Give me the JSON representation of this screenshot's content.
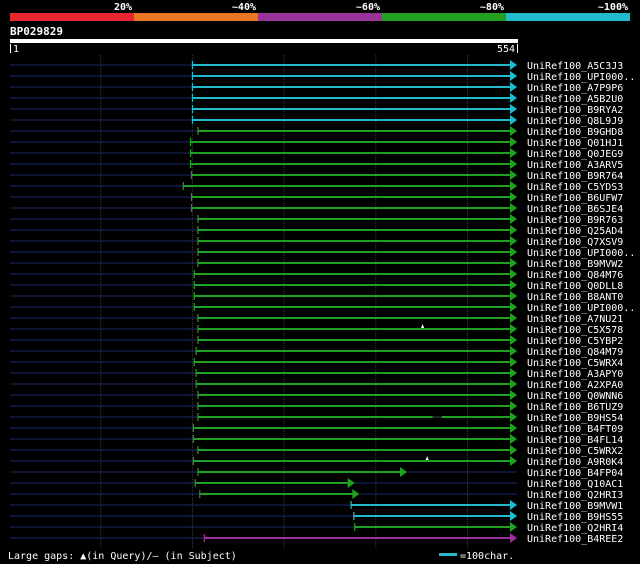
{
  "query": {
    "id": "BP029829",
    "start": "1",
    "end": "554",
    "length": 554
  },
  "identity_scale": [
    {
      "label": "20%",
      "color": "#e8262f"
    },
    {
      "label": "~40%",
      "color": "#e87722"
    },
    {
      "label": "~60%",
      "color": "#993399"
    },
    {
      "label": "~80%",
      "color": "#22a022"
    },
    {
      "label": "~100%",
      "color": "#22bbcc"
    }
  ],
  "footer": {
    "gaps_label": "Large gaps: ▲(in Query)/– (in Subject)",
    "scale_label": "=100char."
  },
  "chart_data": {
    "type": "alignment",
    "x_range": [
      1,
      554
    ],
    "tick_step": 100,
    "colors": {
      "100": "#22bbcc",
      "80": "#22a022",
      "60": "#993399"
    },
    "hits": [
      {
        "name": "UniRef100_A5C3J3",
        "start": 200,
        "end": 554,
        "identity": "100"
      },
      {
        "name": "UniRef100_UPI000..",
        "start": 200,
        "end": 554,
        "identity": "100"
      },
      {
        "name": "UniRef100_A7P9P6",
        "start": 200,
        "end": 554,
        "identity": "100"
      },
      {
        "name": "UniRef100_A5B2U0",
        "start": 200,
        "end": 554,
        "identity": "100"
      },
      {
        "name": "UniRef100_B9RYA2",
        "start": 200,
        "end": 554,
        "identity": "100"
      },
      {
        "name": "UniRef100_Q8L9J9",
        "start": 200,
        "end": 554,
        "identity": "100"
      },
      {
        "name": "UniRef100_B9GHD8",
        "start": 206,
        "end": 554,
        "identity": "80"
      },
      {
        "name": "UniRef100_Q01HJ1",
        "start": 198,
        "end": 554,
        "identity": "80"
      },
      {
        "name": "UniRef100_Q0JEG9",
        "start": 198,
        "end": 554,
        "identity": "80"
      },
      {
        "name": "UniRef100_A3ARV5",
        "start": 198,
        "end": 554,
        "identity": "80"
      },
      {
        "name": "UniRef100_B9R764",
        "start": 199,
        "end": 554,
        "identity": "80"
      },
      {
        "name": "UniRef100_C5YDS3",
        "start": 190,
        "end": 554,
        "identity": "80"
      },
      {
        "name": "UniRef100_B6UFW7",
        "start": 199,
        "end": 554,
        "identity": "80"
      },
      {
        "name": "UniRef100_B6SJE4",
        "start": 199,
        "end": 554,
        "identity": "80"
      },
      {
        "name": "UniRef100_B9R763",
        "start": 206,
        "end": 554,
        "identity": "80"
      },
      {
        "name": "UniRef100_Q25AD4",
        "start": 206,
        "end": 554,
        "identity": "80"
      },
      {
        "name": "UniRef100_Q7XSV9",
        "start": 206,
        "end": 554,
        "identity": "80"
      },
      {
        "name": "UniRef100_UPI000..",
        "start": 206,
        "end": 554,
        "identity": "80"
      },
      {
        "name": "UniRef100_B9MVW2",
        "start": 206,
        "end": 554,
        "identity": "80"
      },
      {
        "name": "UniRef100_Q84M76",
        "start": 202,
        "end": 554,
        "identity": "80"
      },
      {
        "name": "UniRef100_Q0DLL8",
        "start": 202,
        "end": 554,
        "identity": "80"
      },
      {
        "name": "UniRef100_B8ANT0",
        "start": 202,
        "end": 554,
        "identity": "80"
      },
      {
        "name": "UniRef100_UPI000..",
        "start": 202,
        "end": 554,
        "identity": "80"
      },
      {
        "name": "UniRef100_A7NU21",
        "start": 206,
        "end": 554,
        "identity": "80"
      },
      {
        "name": "UniRef100_C5X578",
        "start": 206,
        "end": 554,
        "identity": "80",
        "gap_query": 451
      },
      {
        "name": "UniRef100_C5YBP2",
        "start": 206,
        "end": 554,
        "identity": "80"
      },
      {
        "name": "UniRef100_Q84M79",
        "start": 204,
        "end": 554,
        "identity": "80"
      },
      {
        "name": "UniRef100_C5WRX4",
        "start": 202,
        "end": 554,
        "identity": "80"
      },
      {
        "name": "UniRef100_A3APY0",
        "start": 204,
        "end": 554,
        "identity": "80"
      },
      {
        "name": "UniRef100_A2XPA0",
        "start": 204,
        "end": 554,
        "identity": "80"
      },
      {
        "name": "UniRef100_Q0WNN6",
        "start": 206,
        "end": 554,
        "identity": "80"
      },
      {
        "name": "UniRef100_B6TUZ9",
        "start": 206,
        "end": 554,
        "identity": "80"
      },
      {
        "name": "UniRef100_B9HS54",
        "start": 206,
        "end": 554,
        "identity": "80",
        "gap_subject": [
          462,
          472
        ]
      },
      {
        "name": "UniRef100_B4FT09",
        "start": 201,
        "end": 554,
        "identity": "80"
      },
      {
        "name": "UniRef100_B4FL14",
        "start": 201,
        "end": 554,
        "identity": "80"
      },
      {
        "name": "UniRef100_C5WRX2",
        "start": 206,
        "end": 554,
        "identity": "80"
      },
      {
        "name": "UniRef100_A9R0K4",
        "start": 201,
        "end": 554,
        "identity": "80",
        "gap_query": 456
      },
      {
        "name": "UniRef100_B4FP04",
        "start": 206,
        "end": 434,
        "identity": "80"
      },
      {
        "name": "UniRef100_Q10AC1",
        "start": 203,
        "end": 377,
        "identity": "80"
      },
      {
        "name": "UniRef100_Q2HRI3",
        "start": 208,
        "end": 382,
        "identity": "80"
      },
      {
        "name": "UniRef100_B9MVW1",
        "start": 373,
        "end": 554,
        "identity": "100"
      },
      {
        "name": "UniRef100_B9HS55",
        "start": 376,
        "end": 554,
        "identity": "100"
      },
      {
        "name": "UniRef100_Q2HRI4",
        "start": 377,
        "end": 554,
        "identity": "80"
      },
      {
        "name": "UniRef100_B4REE2",
        "start": 213,
        "end": 554,
        "identity": "60"
      }
    ]
  }
}
